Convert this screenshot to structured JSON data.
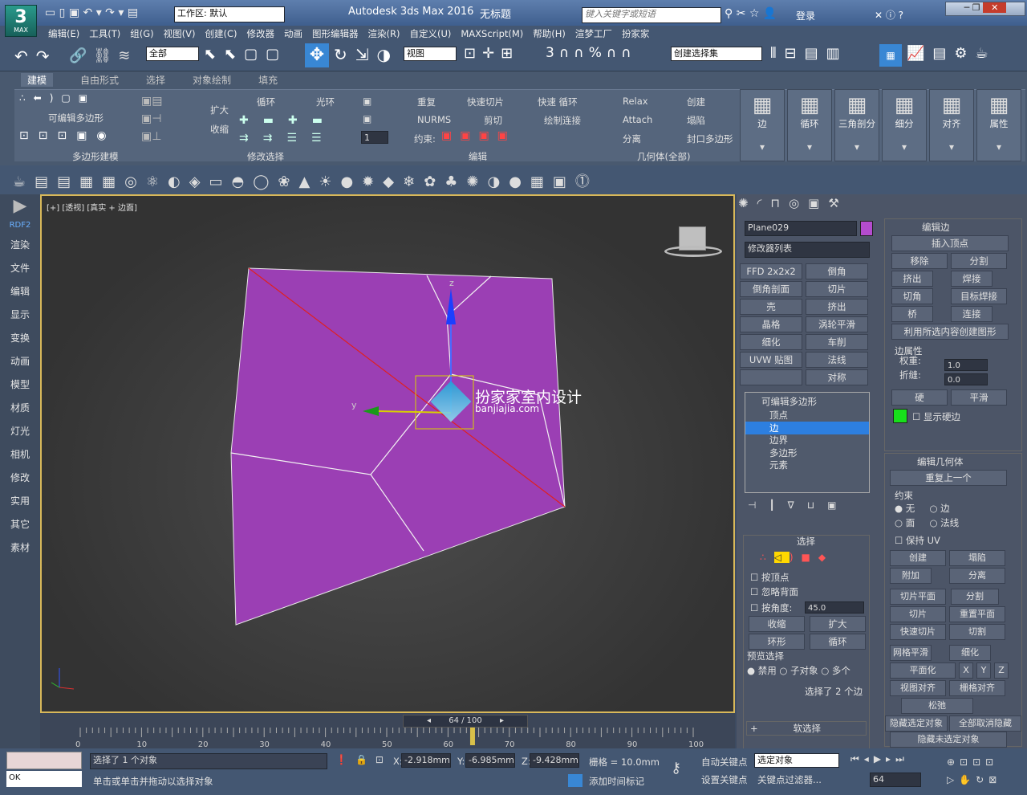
{
  "window": {
    "title": "Autodesk 3ds Max 2016",
    "doc": "无标题",
    "workspace": "工作区: 默认",
    "search_placeholder": "键入关键字或短语",
    "login": "登录",
    "logo": "MAX"
  },
  "menu": [
    "编辑(E)",
    "工具(T)",
    "组(G)",
    "视图(V)",
    "创建(C)",
    "修改器",
    "动画",
    "图形编辑器",
    "渲染(R)",
    "自定义(U)",
    "MAXScript(M)",
    "帮助(H)",
    "渲梦工厂",
    "扮家家"
  ],
  "toolbar": {
    "filter": "全部",
    "coord": "视图",
    "selset": "创建选择集"
  },
  "ribbon": {
    "tabs": [
      "建模",
      "自由形式",
      "选择",
      "对象绘制",
      "填充"
    ],
    "groups": [
      "多边形建模",
      "修改选择",
      "编辑",
      "几何体(全部)"
    ],
    "polymodel_label": "可编辑多边形",
    "modsel": [
      "扩大",
      "收缩",
      "循环",
      "光环"
    ],
    "edit": [
      "重复",
      "快速切片",
      "快速 循环",
      "NURMS",
      "剪切",
      "绘制连接",
      "约束:"
    ],
    "geo": [
      "Relax",
      "创建",
      "Attach",
      "塌陷",
      "分离",
      "封口多边形"
    ],
    "big": [
      "边",
      "循环",
      "三角剖分",
      "细分",
      "对齐",
      "属性"
    ],
    "spinner": "1"
  },
  "left_panel": [
    "RDF2",
    "渲染",
    "文件",
    "编辑",
    "显示",
    "变换",
    "动画",
    "模型",
    "材质",
    "灯光",
    "相机",
    "修改",
    "实用",
    "其它",
    "素材"
  ],
  "viewport": {
    "label": "[+] [透视] [真实 + 边面]",
    "watermark": "扮家家室内设计",
    "watermark_url": "banjiajia.com",
    "axis_z": "z",
    "axis_y": "y",
    "axis_x": "x"
  },
  "object_name": "Plane029",
  "object_color": "#b44ccf",
  "modlist": "修改器列表",
  "modifiers": [
    [
      "FFD 2x2x2",
      "倒角"
    ],
    [
      "倒角剖面",
      "切片"
    ],
    [
      "壳",
      "挤出"
    ],
    [
      "晶格",
      "涡轮平滑"
    ],
    [
      "细化",
      "车削"
    ],
    [
      "UVW 贴图",
      "法线"
    ],
    [
      "",
      "对称"
    ]
  ],
  "stack": {
    "root": "可编辑多边形",
    "items": [
      "顶点",
      "边",
      "边界",
      "多边形",
      "元素"
    ],
    "selected": "边"
  },
  "selection": {
    "header": "选择",
    "by_vertex": "按顶点",
    "ignore_back": "忽略背面",
    "by_angle": "按角度:",
    "angle": "45.0",
    "shrink": "收缩",
    "grow": "扩大",
    "ring": "环形",
    "loop": "循环",
    "preview": "预览选择",
    "disabled": "禁用",
    "subobj": "子对象",
    "multi": "多个",
    "status": "选择了 2 个边"
  },
  "soft": "软选择",
  "edit_edges": {
    "header": "编辑边",
    "insert_vertex": "插入顶点",
    "remove": "移除",
    "split": "分割",
    "extrude": "挤出",
    "weld": "焊接",
    "chamfer": "切角",
    "target_weld": "目标焊接",
    "bridge": "桥",
    "connect": "连接",
    "create_shape": "利用所选内容创建图形",
    "edge_props": "边属性",
    "weight": "权重:",
    "weight_val": "1.0",
    "crease": "折缝:",
    "crease_val": "0.0",
    "hard": "硬",
    "smooth": "平滑",
    "show_hard": "显示硬边"
  },
  "edit_geo": {
    "header": "编辑几何体",
    "repeat": "重复上一个",
    "constraint": "约束",
    "none": "无",
    "edge": "边",
    "face": "面",
    "normal": "法线",
    "keep_uv": "保持 UV",
    "create": "创建",
    "collapse": "塌陷",
    "attach": "附加",
    "detach": "分离",
    "slice_plane": "切片平面",
    "split": "分割",
    "slice": "切片",
    "reset_plane": "重置平面",
    "quickslice": "快速切片",
    "cut": "切割",
    "msmooth": "网格平滑",
    "tessellate": "细化",
    "planarize": "平面化",
    "x": "X",
    "y": "Y",
    "z": "Z",
    "view_align": "视图对齐",
    "grid_align": "栅格对齐",
    "relax": "松弛",
    "hide_sel": "隐藏选定对象",
    "unhide_all": "全部取消隐藏",
    "hide_unsel": "隐藏未选定对象"
  },
  "timeline": {
    "frame": "64 / 100",
    "ticks": [
      "0",
      "10",
      "20",
      "30",
      "40",
      "50",
      "60",
      "70",
      "80",
      "90",
      "100"
    ],
    "current": 64
  },
  "status": {
    "msg1": "选择了 1 个对象",
    "msg2": "单击或单击并拖动以选择对象",
    "ok": "OK",
    "x": "-2.918mm",
    "y": "-6.985mm",
    "z": "-9.428mm",
    "grid": "栅格 = 10.0mm",
    "autokey": "自动关键点",
    "setkey": "设置关键点",
    "selobj": "选定对象",
    "keyfilter": "关键点过滤器...",
    "frame": "64",
    "addtime": "添加时间标记"
  }
}
